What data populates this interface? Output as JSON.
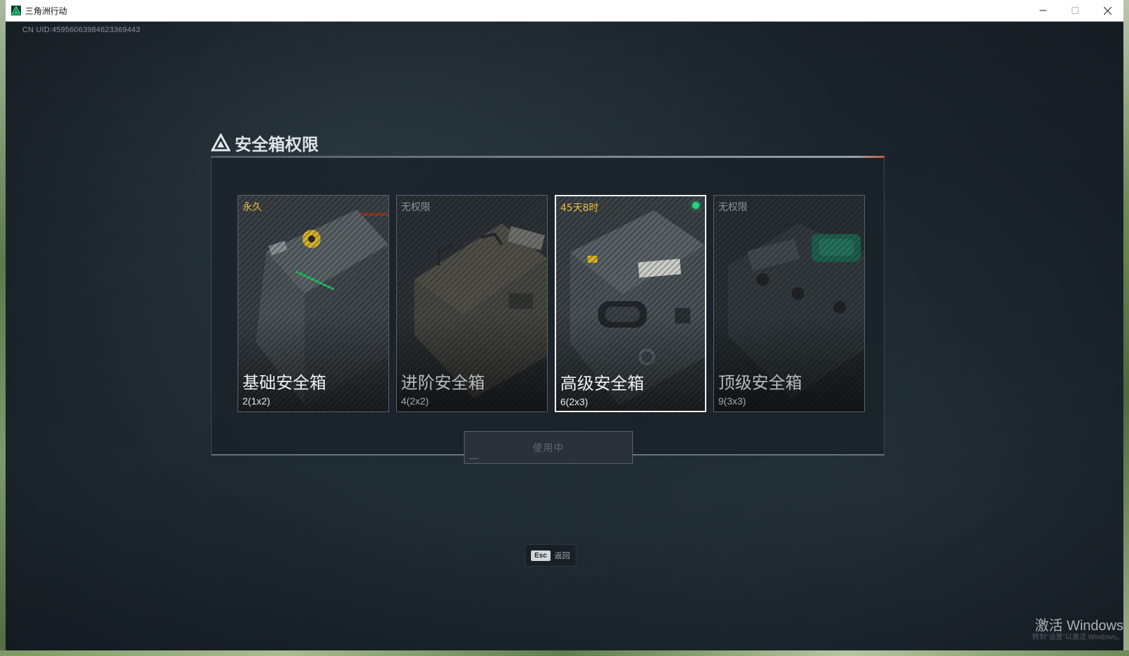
{
  "window": {
    "title": "三角洲行动",
    "controls": [
      "minimize",
      "maximize",
      "close"
    ]
  },
  "uid_text": "CN UID:4595606398462336​9443",
  "panel": {
    "title": "安全箱权限",
    "cards": [
      {
        "status": "永久",
        "name": "基础安全箱",
        "capacity": "2(1x2)",
        "locked": false,
        "selected": false
      },
      {
        "status": "无权限",
        "name": "进阶安全箱",
        "capacity": "4(2x2)",
        "locked": true,
        "selected": false
      },
      {
        "status": "45天8时",
        "name": "高级安全箱",
        "capacity": "6(2x3)",
        "locked": false,
        "selected": true,
        "active": true
      },
      {
        "status": "无权限",
        "name": "顶级安全箱",
        "capacity": "9(3x3)",
        "locked": true,
        "selected": false
      }
    ],
    "action_button": "使用中"
  },
  "footer": {
    "key": "Esc",
    "label": "返回"
  },
  "watermark": {
    "text": "激活 Windows",
    "subtext": "转到\"设置\"以激活 Windows。"
  },
  "colors": {
    "status_active": "#f0bd3e",
    "active_dot": "#21d67e",
    "accent_line_end": "#c45a3a"
  }
}
